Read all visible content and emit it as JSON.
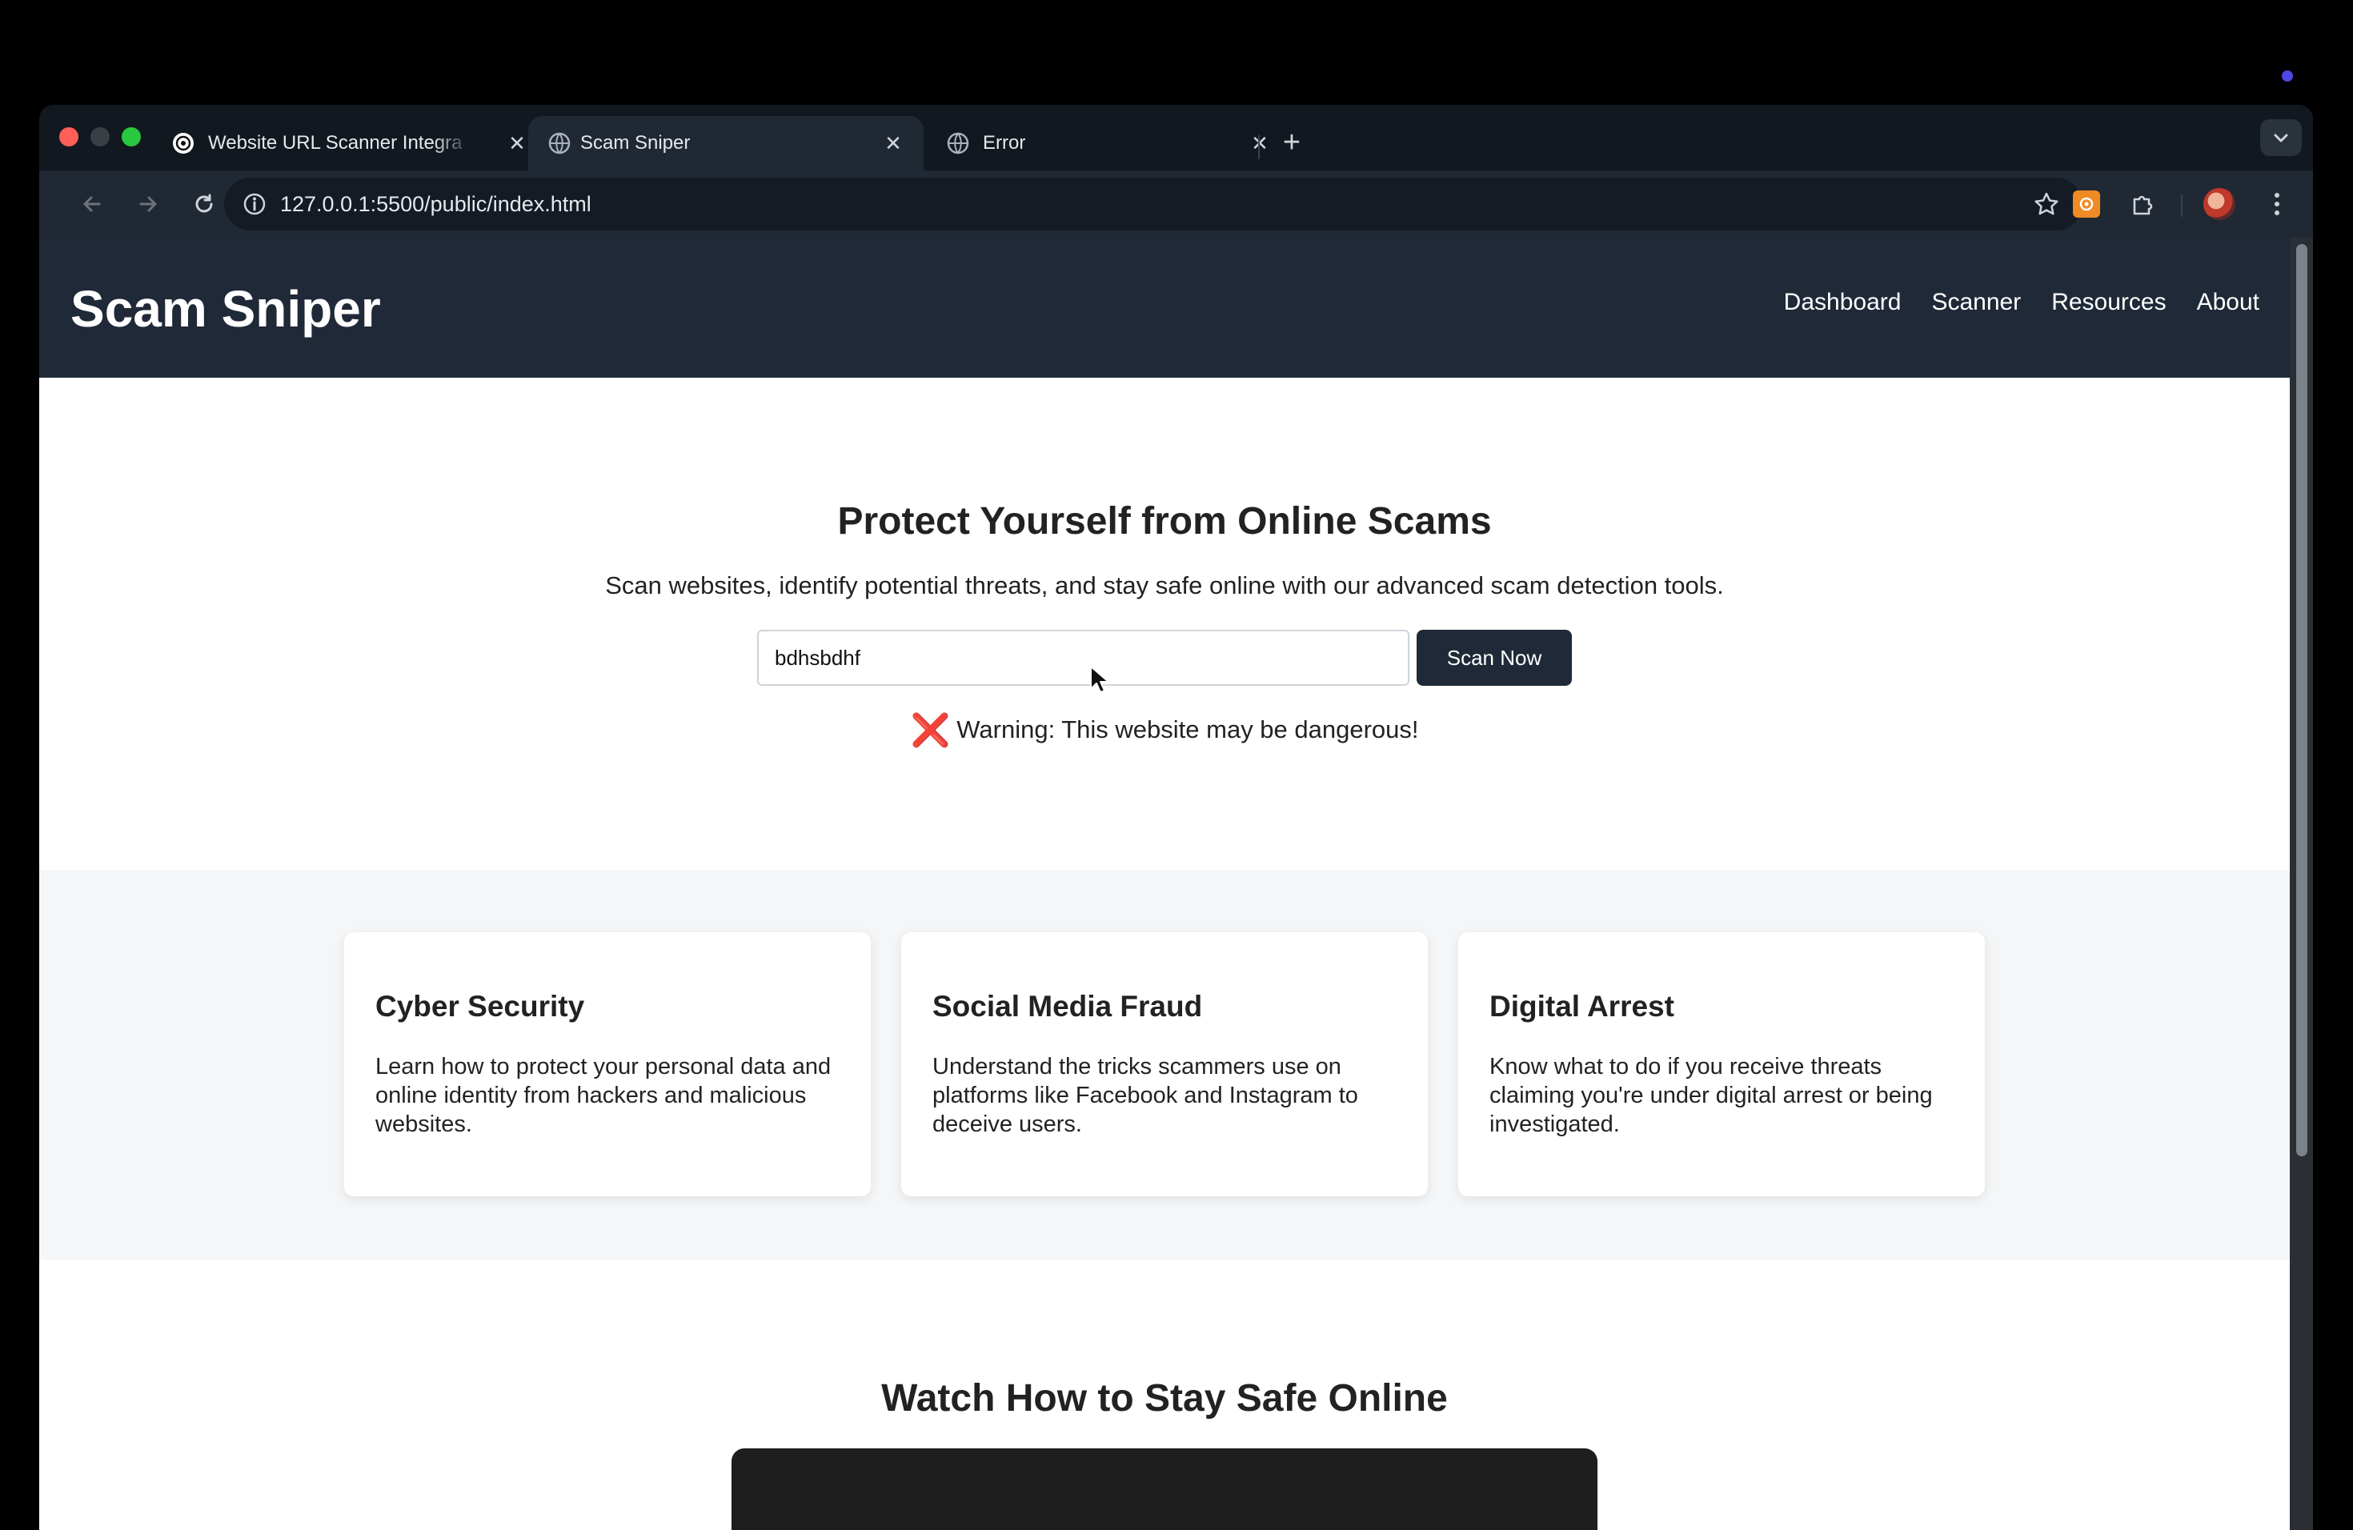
{
  "browser": {
    "tabs": [
      {
        "title": "Website URL Scanner Integra",
        "favicon": "openai-icon",
        "active": false
      },
      {
        "title": "Scam Sniper",
        "favicon": "globe-icon",
        "active": true
      },
      {
        "title": "Error",
        "favicon": "globe-icon",
        "active": false
      }
    ],
    "url": "127.0.0.1:5500/public/index.html"
  },
  "site": {
    "brand": "Scam Sniper",
    "nav": [
      "Dashboard",
      "Scanner",
      "Resources",
      "About"
    ]
  },
  "hero": {
    "title": "Protect Yourself from Online Scams",
    "subtitle": "Scan websites, identify potential threats, and stay safe online with our advanced scam detection tools.",
    "input_value": "bdhsbdhf",
    "scan_button": "Scan Now",
    "warning_icon": "❌",
    "warning_text": "Warning: This website may be dangerous!"
  },
  "features": [
    {
      "title": "Cyber Security",
      "text": "Learn how to protect your personal data and online identity from hackers and malicious websites."
    },
    {
      "title": "Social Media Fraud",
      "text": "Understand the tricks scammers use on platforms like Facebook and Instagram to deceive users."
    },
    {
      "title": "Digital Arrest",
      "text": "Know what to do if you receive threats claiming you're under digital arrest or being investigated."
    }
  ],
  "video": {
    "title": "Watch How to Stay Safe Online"
  },
  "colors": {
    "header_bg": "#1f2937",
    "button_bg": "#1f2937",
    "warning_x": "#d32020",
    "features_bg": "#f4f6f8"
  }
}
